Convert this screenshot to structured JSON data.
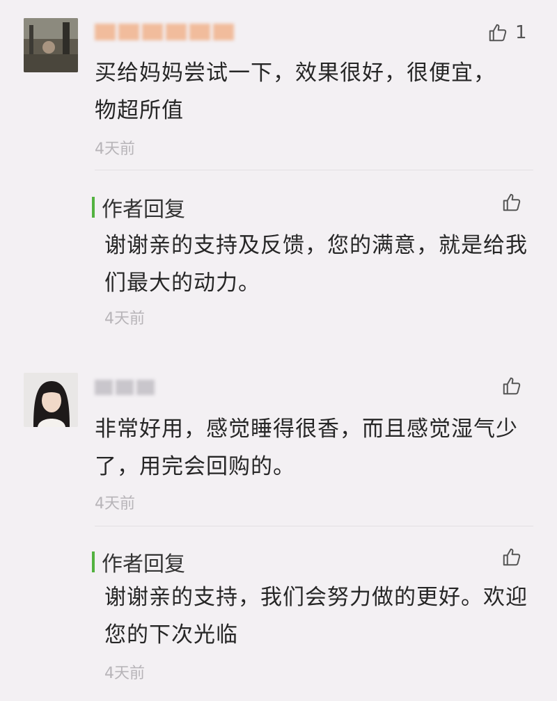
{
  "comments": [
    {
      "text": "买给妈妈尝试一下，效果很好，很便宜，物超所值",
      "time": "4天前",
      "like_count": "1",
      "reply": {
        "label": "作者回复",
        "text": "谢谢亲的支持及反馈，您的满意，就是给我们最大的动力。",
        "time": "4天前"
      }
    },
    {
      "text": "非常好用，感觉睡得很香，而且感觉湿气少了，用完会回购的。",
      "time": "4天前",
      "like_count": "",
      "reply": {
        "label": "作者回复",
        "text": "谢谢亲的支持，我们会努力做的更好。欢迎您的下次光临",
        "time": "4天前"
      }
    }
  ],
  "colors": {
    "background": "#f3f0f3",
    "reply_accent": "#53b240",
    "time_text": "#b7b4b8"
  },
  "icons": [
    "thumb-up-icon"
  ]
}
